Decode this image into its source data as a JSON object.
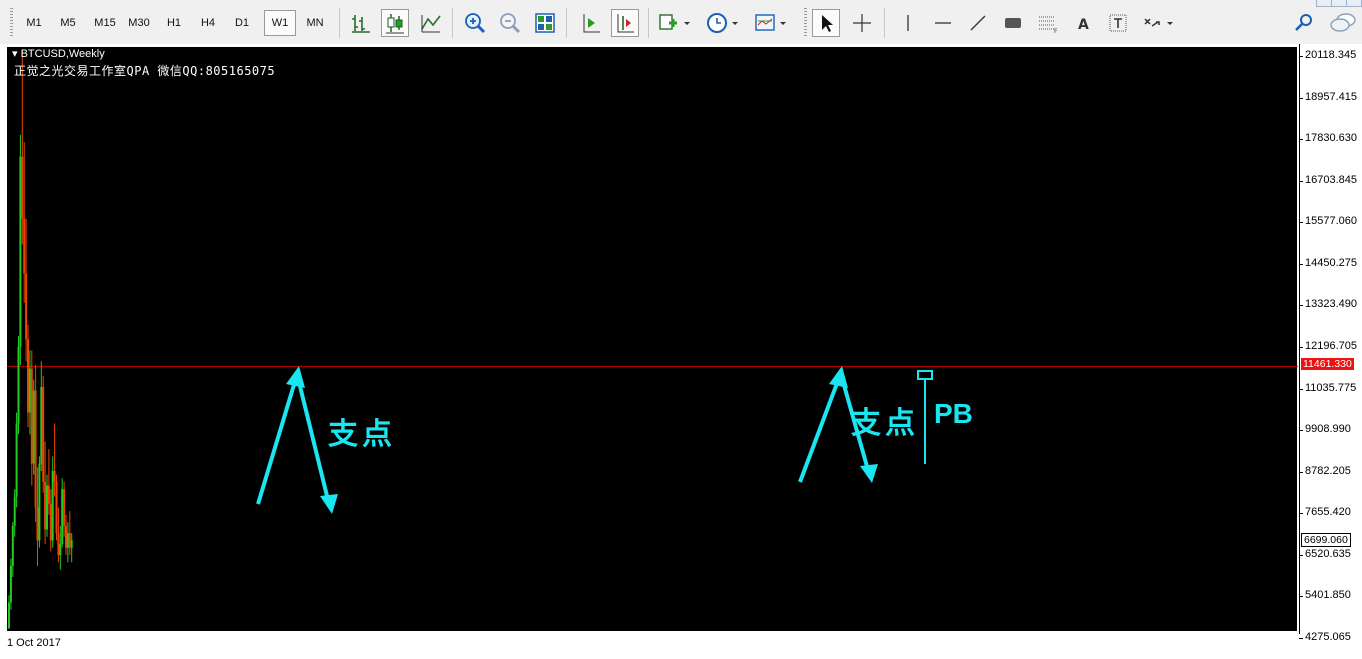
{
  "toolbar": {
    "timeframes": [
      {
        "label": "M1",
        "active": false
      },
      {
        "label": "M5",
        "active": false
      },
      {
        "label": "M15",
        "active": false
      },
      {
        "label": "M30",
        "active": false
      },
      {
        "label": "H1",
        "active": false
      },
      {
        "label": "H4",
        "active": false
      },
      {
        "label": "D1",
        "active": false
      },
      {
        "label": "W1",
        "active": true
      },
      {
        "label": "MN",
        "active": false
      }
    ],
    "icons": [
      "bar-chart-icon",
      "candlestick-icon",
      "line-chart-icon",
      "zoom-in-icon",
      "zoom-out-icon",
      "tile-windows-icon",
      "autoscroll-icon",
      "chart-shift-icon",
      "indicators-icon",
      "periods-clock-icon",
      "templates-icon",
      "cursor-icon",
      "crosshair-icon",
      "vertical-line-icon",
      "horizontal-line-icon",
      "trendline-icon",
      "rectangle-icon",
      "fibonacci-icon",
      "text-icon",
      "text-label-icon",
      "arrows-icon",
      "search-icon",
      "chat-icon"
    ],
    "text_tool_label": "A"
  },
  "chart": {
    "symbol": "BTCUSD,Weekly",
    "watermark": "正觉之光交易工作室QPA 微信QQ:805165075",
    "date_label": "1 Oct 2017",
    "price_labels": [
      "20118.345",
      "18957.415",
      "17830.630",
      "16703.845",
      "15577.060",
      "14450.275",
      "13323.490",
      "12196.705",
      "11035.775",
      "9908.990",
      "8782.205",
      "7655.420",
      "6520.635",
      "5401.850",
      "4275.065"
    ],
    "current_price": "11461.330",
    "bid_price": "6699.060",
    "annotations": {
      "support_left": "支点",
      "support_right": "支点",
      "pb_label": "PB"
    },
    "colors": {
      "background": "#000000",
      "bull_candle": "#22cc22",
      "bear_candle": "#ee4400",
      "price_line": "#cc0000",
      "annotation": "#19e6f0"
    }
  },
  "chart_data": {
    "type": "candlestick",
    "title": "BTCUSD,Weekly",
    "ylim": [
      4275.065,
      20118.345
    ],
    "x_start": "1 Oct 2017",
    "price_line": 11461.33,
    "candles": [
      {
        "o": 4300,
        "h": 5200,
        "l": 4275,
        "c": 5000
      },
      {
        "o": 5000,
        "h": 6200,
        "l": 4800,
        "c": 6000
      },
      {
        "o": 6000,
        "h": 7200,
        "l": 5700,
        "c": 7100
      },
      {
        "o": 7100,
        "h": 8100,
        "l": 6800,
        "c": 7900
      },
      {
        "o": 7900,
        "h": 10200,
        "l": 7600,
        "c": 9900
      },
      {
        "o": 9900,
        "h": 12300,
        "l": 9600,
        "c": 12000
      },
      {
        "o": 12000,
        "h": 17800,
        "l": 11500,
        "c": 17200
      },
      {
        "o": 17200,
        "h": 20118,
        "l": 14800,
        "c": 15500
      },
      {
        "o": 15500,
        "h": 17600,
        "l": 13200,
        "c": 14000
      },
      {
        "o": 14000,
        "h": 15500,
        "l": 11600,
        "c": 12200
      },
      {
        "o": 12200,
        "h": 12600,
        "l": 9800,
        "c": 10200
      },
      {
        "o": 10200,
        "h": 11900,
        "l": 9600,
        "c": 11400
      },
      {
        "o": 11400,
        "h": 11900,
        "l": 8200,
        "c": 8800
      },
      {
        "o": 8800,
        "h": 11100,
        "l": 8500,
        "c": 10800
      },
      {
        "o": 10800,
        "h": 11500,
        "l": 7200,
        "c": 7600
      },
      {
        "o": 7600,
        "h": 8700,
        "l": 6000,
        "c": 6700
      },
      {
        "o": 6700,
        "h": 9000,
        "l": 6500,
        "c": 8800
      },
      {
        "o": 8800,
        "h": 11600,
        "l": 8600,
        "c": 10900
      },
      {
        "o": 10900,
        "h": 11200,
        "l": 8000,
        "c": 8300
      },
      {
        "o": 8300,
        "h": 9400,
        "l": 6600,
        "c": 7000
      },
      {
        "o": 7000,
        "h": 8500,
        "l": 6800,
        "c": 8200
      },
      {
        "o": 8200,
        "h": 9200,
        "l": 7400,
        "c": 7700
      },
      {
        "o": 7700,
        "h": 8100,
        "l": 6400,
        "c": 6700
      },
      {
        "o": 6700,
        "h": 9000,
        "l": 6500,
        "c": 8600
      },
      {
        "o": 8600,
        "h": 9900,
        "l": 7900,
        "c": 8300
      },
      {
        "o": 8300,
        "h": 8500,
        "l": 6700,
        "c": 6900
      },
      {
        "o": 6900,
        "h": 7600,
        "l": 6100,
        "c": 6300
      },
      {
        "o": 6300,
        "h": 7100,
        "l": 5900,
        "c": 6600
      },
      {
        "o": 6600,
        "h": 8400,
        "l": 6500,
        "c": 8100
      },
      {
        "o": 8100,
        "h": 8300,
        "l": 6800,
        "c": 7100
      },
      {
        "o": 7100,
        "h": 7400,
        "l": 6300,
        "c": 6500
      },
      {
        "o": 6500,
        "h": 7200,
        "l": 6100,
        "c": 6900
      },
      {
        "o": 6900,
        "h": 7500,
        "l": 6300,
        "c": 6500
      },
      {
        "o": 6500,
        "h": 6900,
        "l": 6100,
        "c": 6699
      }
    ]
  }
}
